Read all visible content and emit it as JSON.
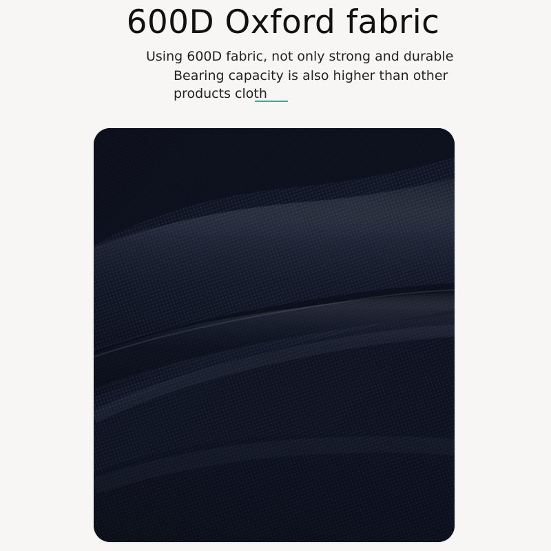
{
  "title": "600D Oxford fabric",
  "description": {
    "line1": "Using 600D fabric, not only strong and durable",
    "line2": "Bearing capacity is also higher than other",
    "line3": "products cloth"
  },
  "colors": {
    "background": "#f7f6f4",
    "title_text": "#111111",
    "body_text": "#222222",
    "accent": "#3aa993",
    "fabric_base": "#141928"
  }
}
